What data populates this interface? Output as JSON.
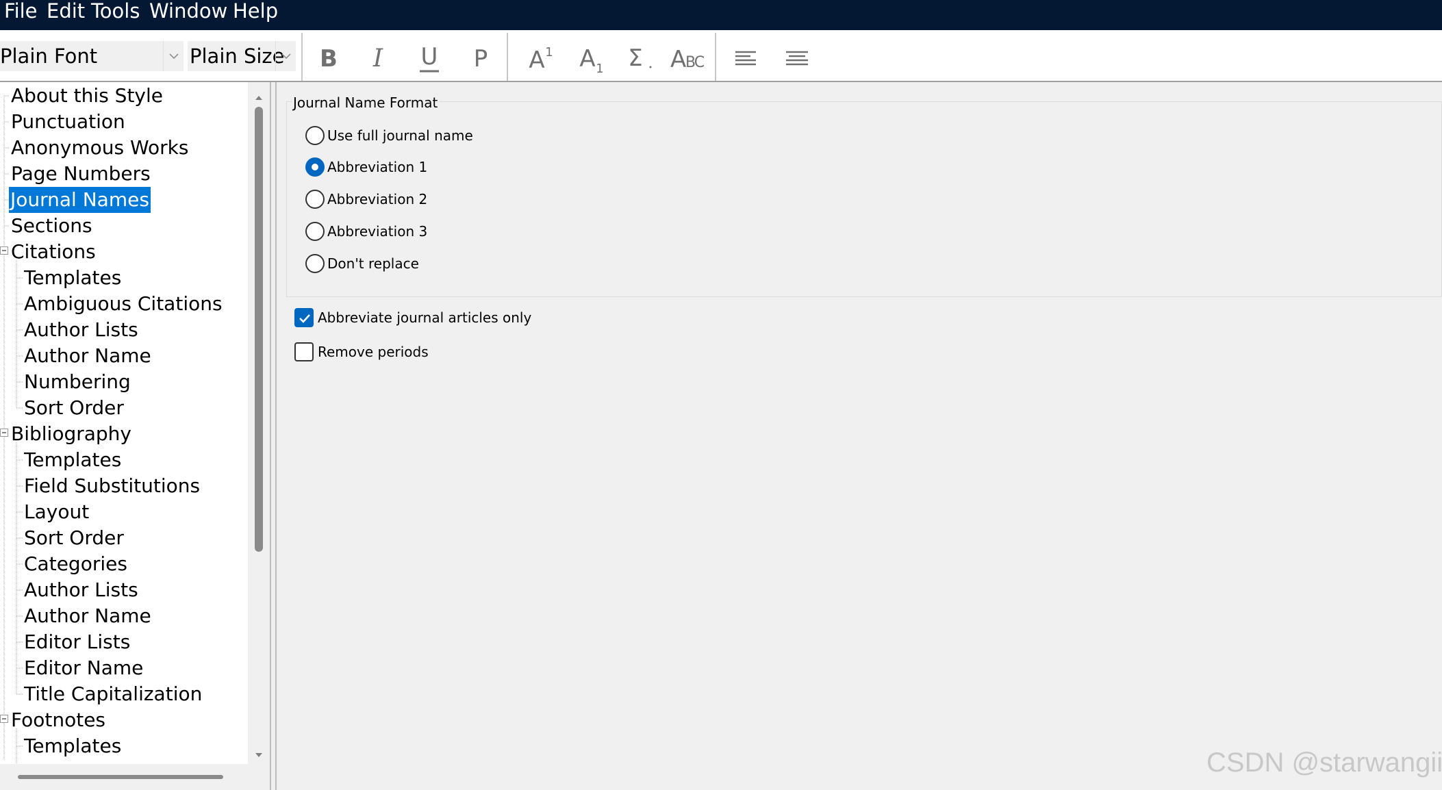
{
  "menu": {
    "items": [
      {
        "label": "File"
      },
      {
        "label": "Edit"
      },
      {
        "label": "Tools"
      },
      {
        "label": "Window"
      },
      {
        "label": "Help"
      }
    ]
  },
  "toolbar": {
    "font_value": "Plain Font",
    "size_value": "Plain Size",
    "buttons": [
      "bold",
      "italic",
      "underline",
      "plain",
      "superscript",
      "subscript",
      "symbol",
      "small-caps",
      "align-left",
      "align-center"
    ]
  },
  "tree": {
    "selected": "Journal Names",
    "items": [
      {
        "label": "About this Style"
      },
      {
        "label": "Punctuation"
      },
      {
        "label": "Anonymous Works"
      },
      {
        "label": "Page Numbers"
      },
      {
        "label": "Journal Names"
      },
      {
        "label": "Sections"
      },
      {
        "label": "Citations"
      },
      {
        "label": "Templates"
      },
      {
        "label": "Ambiguous Citations"
      },
      {
        "label": "Author Lists"
      },
      {
        "label": "Author Name"
      },
      {
        "label": "Numbering"
      },
      {
        "label": "Sort Order"
      },
      {
        "label": "Bibliography"
      },
      {
        "label": "Templates"
      },
      {
        "label": "Field Substitutions"
      },
      {
        "label": "Layout"
      },
      {
        "label": "Sort Order"
      },
      {
        "label": "Categories"
      },
      {
        "label": "Author Lists"
      },
      {
        "label": "Author Name"
      },
      {
        "label": "Editor Lists"
      },
      {
        "label": "Editor Name"
      },
      {
        "label": "Title Capitalization"
      },
      {
        "label": "Footnotes"
      },
      {
        "label": "Templates"
      }
    ]
  },
  "journal_format": {
    "group_title": "Journal Name Format",
    "options": [
      {
        "label": "Use full journal name",
        "selected": false
      },
      {
        "label": "Abbreviation 1",
        "selected": true
      },
      {
        "label": "Abbreviation 2",
        "selected": false
      },
      {
        "label": "Abbreviation 3",
        "selected": false
      },
      {
        "label": "Don't replace",
        "selected": false
      }
    ]
  },
  "checkboxes": [
    {
      "label": "Abbreviate journal articles only",
      "checked": true
    },
    {
      "label": "Remove periods",
      "checked": false
    }
  ],
  "watermark": "CSDN @starwangii",
  "colors": {
    "menubar_bg": "#051833",
    "selection": "#0078d7",
    "accent": "#0067c0"
  }
}
